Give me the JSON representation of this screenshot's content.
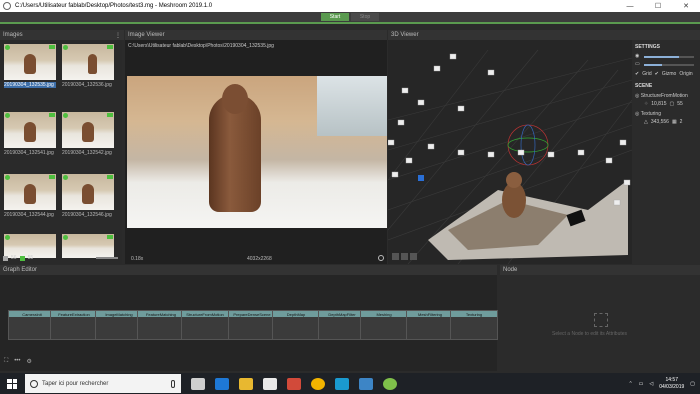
{
  "window": {
    "title": "C:/Users/Utilisateur fablab/Desktop/Photos/test3.mg - Meshroom 2019.1.0",
    "minimize_label": "—",
    "maximize_label": "☐",
    "close_label": "✕"
  },
  "toolbar": {
    "start_label": "Start",
    "stop_label": "Stop"
  },
  "images_panel": {
    "header": "Images",
    "menu_glyph": "⋮",
    "thumbnails": [
      {
        "label": "20190304_132535.jpg",
        "selected": true
      },
      {
        "label": "20190304_132536.jpg",
        "selected": false
      },
      {
        "label": "20190304_132541.jpg",
        "selected": false
      },
      {
        "label": "20190304_132542.jpg",
        "selected": false
      },
      {
        "label": "20190304_132544.jpg",
        "selected": false
      },
      {
        "label": "20190304_132546.jpg",
        "selected": false
      }
    ],
    "count_total": "56",
    "count_reconstructed": "55"
  },
  "image_viewer": {
    "header": "Image Viewer",
    "path": "C:\\Users\\Utilisateur fablab\\Desktop\\Photos\\20190304_132535.jpg",
    "zoom": "0.18x",
    "resolution": "4032x2268"
  },
  "viewer3d": {
    "header": "3D Viewer"
  },
  "settings": {
    "title": "SETTINGS",
    "grid_label": "Grid",
    "gizmo_label": "Gizmo",
    "origin_label": "Origin",
    "scene_title": "SCENE",
    "sfm_label": "StructureFromMotion",
    "sfm_points": "10,815",
    "sfm_cameras": "55",
    "texturing_label": "Texturing",
    "tex_faces": "343,556",
    "tex_materials": "2",
    "slider1": 0.7,
    "slider2": 0.35
  },
  "graph_editor": {
    "header": "Graph Editor",
    "nodes": [
      "CameraInit",
      "FeatureExtraction",
      "ImageMatching",
      "FeatureMatching",
      "StructureFromMotion",
      "PrepareDenseScene",
      "DepthMap",
      "DepthMapFilter",
      "Meshing",
      "MeshFiltering",
      "Texturing"
    ]
  },
  "node_panel": {
    "header": "Node",
    "hint": "Select a Node to edit its Attributes"
  },
  "taskbar": {
    "search_placeholder": "Taper ici pour rechercher",
    "time": "14:57",
    "date": "04/03/2019"
  },
  "colors": {
    "accent_green": "#5a9a4f",
    "selection_blue": "#3d6ea8"
  }
}
